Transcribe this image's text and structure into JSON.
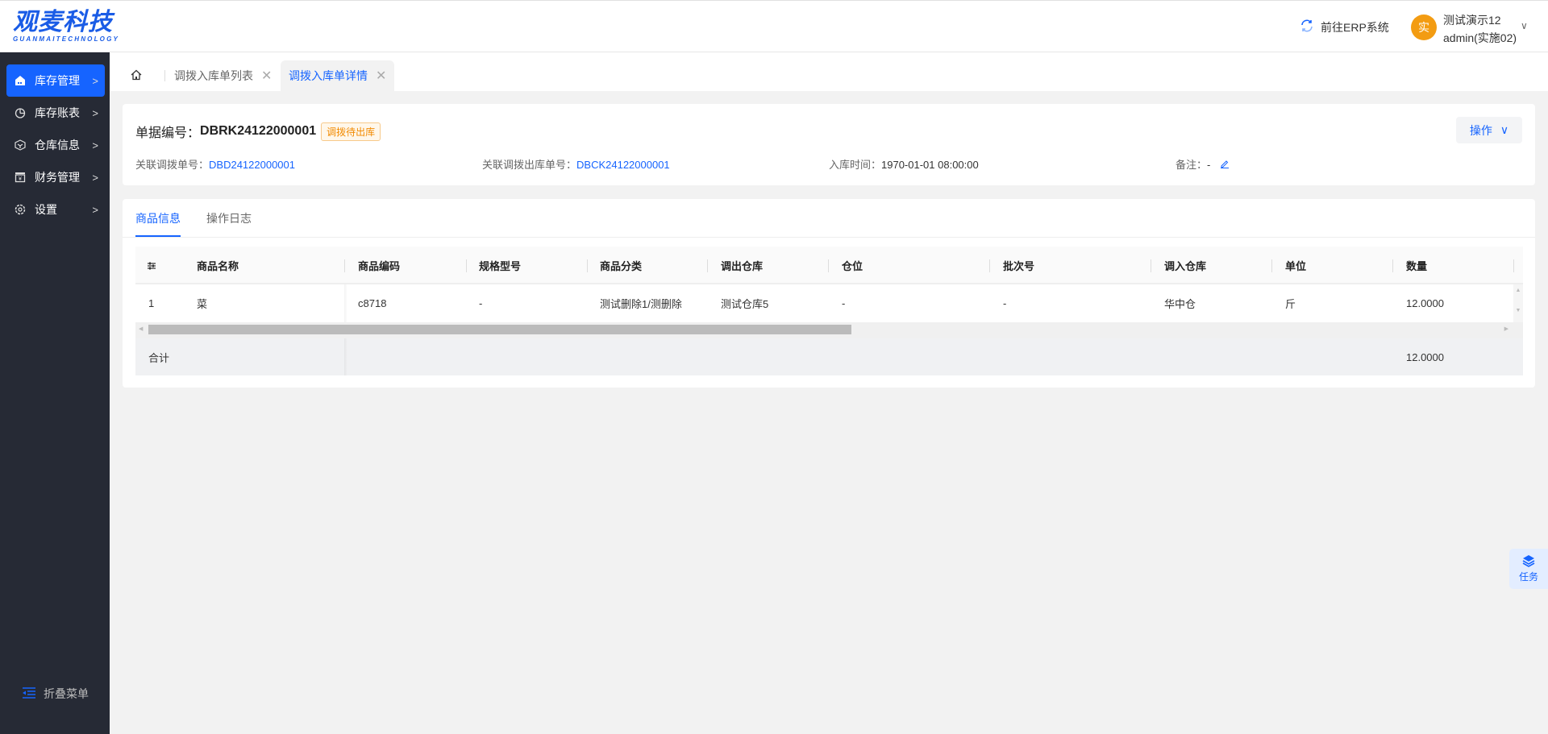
{
  "header": {
    "logo_cn": "观麦科技",
    "logo_en": "GUANMAITECHNOLOGY",
    "erp_link": "前往ERP系统",
    "avatar_char": "实",
    "user_name": "测试演示12",
    "user_account": "admin(实施02)"
  },
  "sidebar": {
    "items": [
      {
        "label": "库存管理",
        "icon": "warehouse-icon"
      },
      {
        "label": "库存账表",
        "icon": "pie-chart-icon"
      },
      {
        "label": "仓库信息",
        "icon": "cube-icon"
      },
      {
        "label": "财务管理",
        "icon": "finance-icon"
      },
      {
        "label": "设置",
        "icon": "gear-icon"
      }
    ],
    "collapse": "折叠菜单"
  },
  "tabs": [
    {
      "label": "调拨入库单列表"
    },
    {
      "label": "调拨入库单详情"
    }
  ],
  "doc": {
    "label": "单据编号：",
    "number": "DBRK24122000001",
    "status": "调拨待出库",
    "op_button": "操作",
    "meta": [
      {
        "label": "关联调拨单号：",
        "value": "DBD24122000001"
      },
      {
        "label": "关联调拨出库单号：",
        "value": "DBCK24122000001"
      },
      {
        "label": "入库时间：",
        "value": "1970-01-01 08:00:00"
      },
      {
        "label": "备注：",
        "value": "-"
      }
    ]
  },
  "detail_tabs": [
    "商品信息",
    "操作日志"
  ],
  "table": {
    "columns": [
      "商品名称",
      "商品编码",
      "规格型号",
      "商品分类",
      "调出仓库",
      "仓位",
      "批次号",
      "调入仓库",
      "单位",
      "数量"
    ],
    "rows": [
      [
        "1",
        "菜",
        "c8718",
        "-",
        "测试删除1/测删除",
        "测试仓库5",
        "-",
        "-",
        "华中仓",
        "斤",
        "12.0000"
      ]
    ],
    "total_label": "合计",
    "total_qty": "12.0000"
  },
  "task": {
    "label": "任务"
  },
  "colors": {
    "accent": "#1664ff",
    "sidebar": "#262a35",
    "badge": "#f28a00"
  }
}
